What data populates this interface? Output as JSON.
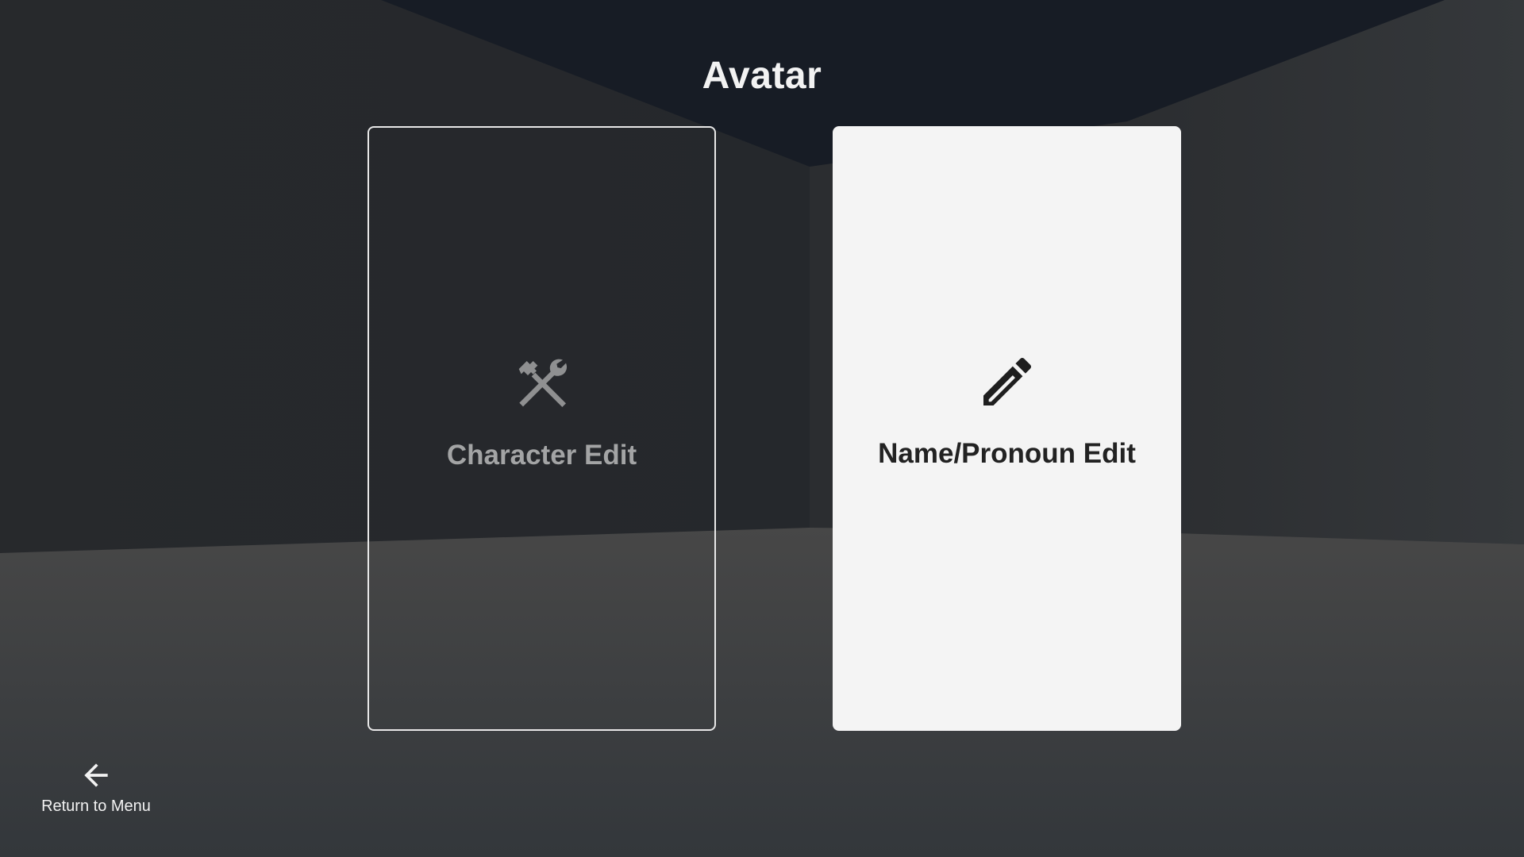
{
  "page": {
    "title": "Avatar"
  },
  "cards": [
    {
      "id": "character-edit",
      "label": "Character Edit",
      "icon": "tools-icon"
    },
    {
      "id": "name-pronoun-edit",
      "label": "Name/Pronoun Edit",
      "icon": "pencil-icon"
    }
  ],
  "navigation": {
    "back_label": "Return to Menu",
    "back_icon": "arrow-left-icon"
  },
  "colors": {
    "background_dark": "#2a2c2f",
    "top_wedge": "#171c25",
    "floor": "#444546",
    "card_light": "#f4f4f4",
    "card_border": "#e8e8e8",
    "muted_text": "#a3a4a5"
  }
}
